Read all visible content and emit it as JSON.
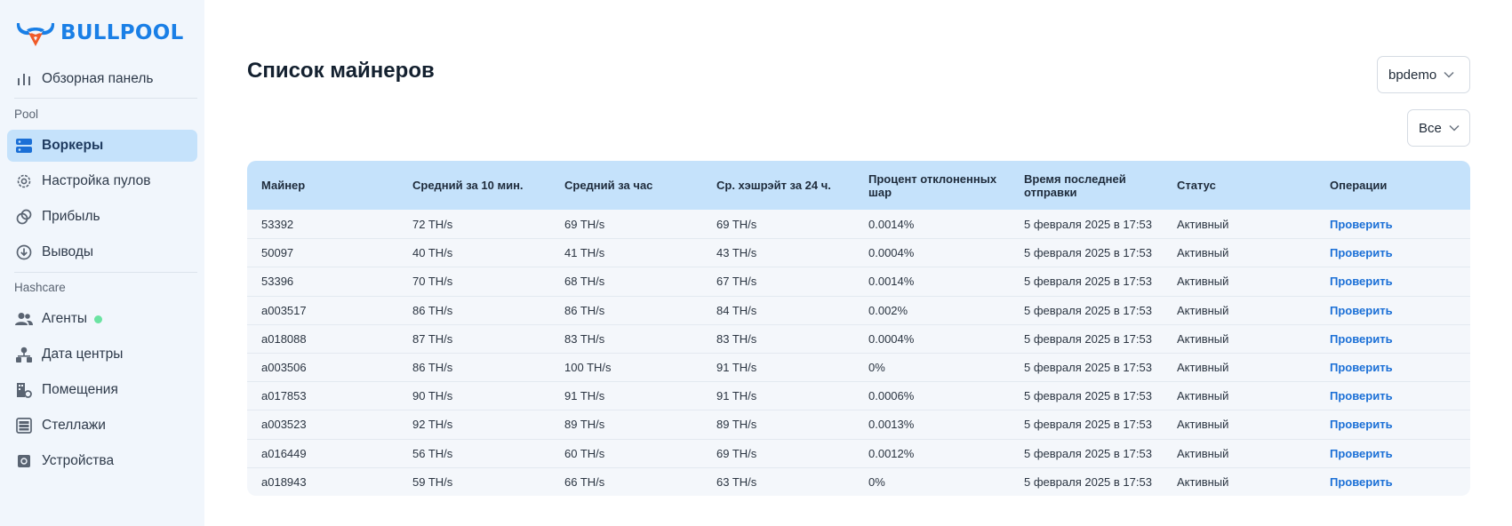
{
  "brand": {
    "name": "BULLPOOL",
    "color": "#1a7fe6",
    "horn_color": "#f05a28"
  },
  "sidebar": {
    "top_item": {
      "label": "Обзорная панель",
      "icon": "bar-chart-icon"
    },
    "sections": [
      {
        "title": "Pool",
        "items": [
          {
            "label": "Воркеры",
            "icon": "server-icon",
            "active": true
          },
          {
            "label": "Настройка пулов",
            "icon": "gear-icon"
          },
          {
            "label": "Прибыль",
            "icon": "coins-icon"
          },
          {
            "label": "Выводы",
            "icon": "download-circle-icon"
          }
        ]
      },
      {
        "title": "Hashcare",
        "items": [
          {
            "label": "Агенты",
            "icon": "users-icon",
            "status_dot": "#3ddc84"
          },
          {
            "label": "Дата центры",
            "icon": "hierarchy-icon"
          },
          {
            "label": "Помещения",
            "icon": "building-gear-icon"
          },
          {
            "label": "Стеллажи",
            "icon": "rack-icon"
          },
          {
            "label": "Устройства",
            "icon": "chip-icon"
          }
        ]
      }
    ]
  },
  "main": {
    "title": "Список майнеров",
    "account_select": {
      "value": "bpdemo"
    },
    "filter_select": {
      "value": "Все"
    },
    "table": {
      "headers": [
        "Майнер",
        "Средний за 10 мин.",
        "Средний за час",
        "Ср. хэшрэйт за 24 ч.",
        "Процент отклоненных шар",
        "Время последней отправки",
        "Статус",
        "Операции"
      ],
      "rows": [
        [
          "53392",
          "72 TH/s",
          "69 TH/s",
          "69 TH/s",
          "0.0014%",
          "5 февраля 2025 в 17:53",
          "Активный",
          "Проверить"
        ],
        [
          "50097",
          "40 TH/s",
          "41 TH/s",
          "43 TH/s",
          "0.0004%",
          "5 февраля 2025 в 17:53",
          "Активный",
          "Проверить"
        ],
        [
          "53396",
          "70 TH/s",
          "68 TH/s",
          "67 TH/s",
          "0.0014%",
          "5 февраля 2025 в 17:53",
          "Активный",
          "Проверить"
        ],
        [
          "a003517",
          "86 TH/s",
          "86 TH/s",
          "84 TH/s",
          "0.002%",
          "5 февраля 2025 в 17:53",
          "Активный",
          "Проверить"
        ],
        [
          "a018088",
          "87 TH/s",
          "83 TH/s",
          "83 TH/s",
          "0.0004%",
          "5 февраля 2025 в 17:53",
          "Активный",
          "Проверить"
        ],
        [
          "a003506",
          "86 TH/s",
          "100 TH/s",
          "91 TH/s",
          "0%",
          "5 февраля 2025 в 17:53",
          "Активный",
          "Проверить"
        ],
        [
          "a017853",
          "90 TH/s",
          "91 TH/s",
          "91 TH/s",
          "0.0006%",
          "5 февраля 2025 в 17:53",
          "Активный",
          "Проверить"
        ],
        [
          "a003523",
          "92 TH/s",
          "89 TH/s",
          "89 TH/s",
          "0.0013%",
          "5 февраля 2025 в 17:53",
          "Активный",
          "Проверить"
        ],
        [
          "a016449",
          "56 TH/s",
          "60 TH/s",
          "69 TH/s",
          "0.0012%",
          "5 февраля 2025 в 17:53",
          "Активный",
          "Проверить"
        ],
        [
          "a018943",
          "59 TH/s",
          "66 TH/s",
          "63 TH/s",
          "0%",
          "5 февраля 2025 в 17:53",
          "Активный",
          "Проверить"
        ]
      ]
    }
  }
}
